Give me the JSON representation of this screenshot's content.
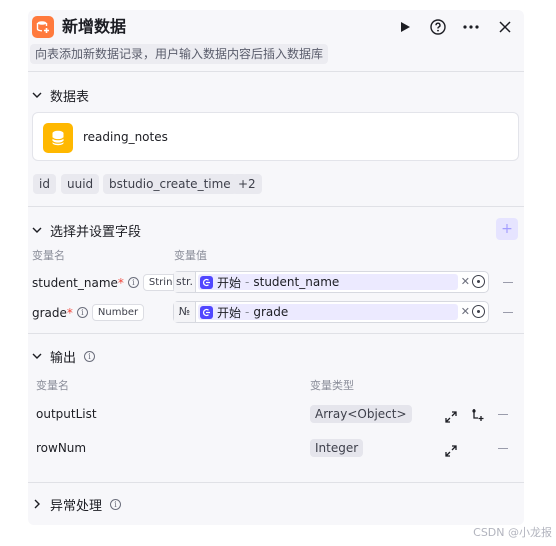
{
  "node": {
    "title": "新增数据",
    "description": "向表添加新数据记录，用户输入数据内容后插入数据库"
  },
  "table_section": {
    "title": "数据表",
    "table_name": "reading_notes",
    "columns": [
      "id",
      "uuid",
      "bstudio_create_time",
      "+2"
    ]
  },
  "fields_section": {
    "title": "选择并设置字段",
    "col_name": "变量名",
    "col_value": "变量值",
    "add_label": "+",
    "rows": [
      {
        "name": "student_name",
        "required": "*",
        "type": "String",
        "prefix": "str.",
        "source": "开始",
        "sep": "-",
        "var": "student_name"
      },
      {
        "name": "grade",
        "required": "*",
        "type": "Number",
        "prefix": "№",
        "source": "开始",
        "sep": "-",
        "var": "grade"
      }
    ]
  },
  "output_section": {
    "title": "输出",
    "col_name": "变量名",
    "col_type": "变量类型",
    "rows": [
      {
        "name": "outputList",
        "type": "Array<Object>"
      },
      {
        "name": "rowNum",
        "type": "Integer"
      }
    ]
  },
  "exception_section": {
    "title": "异常处理"
  },
  "watermark": "CSDN @小龙报",
  "colors": {
    "accent": "#5147ff",
    "node_icon": "#ff7a3d",
    "db_icon": "#ffb800"
  }
}
